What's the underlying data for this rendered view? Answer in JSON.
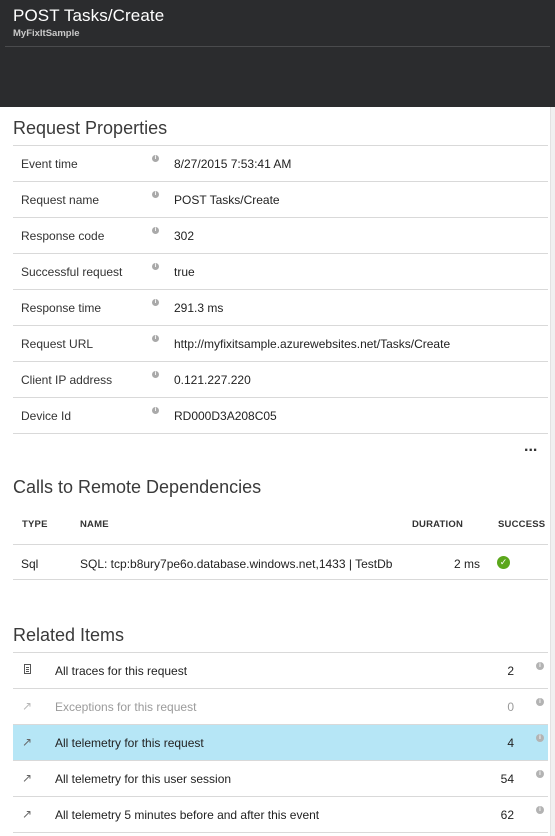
{
  "header": {
    "title": "POST Tasks/Create",
    "subtitle": "MyFixItSample"
  },
  "request_properties": {
    "title": "Request Properties",
    "rows": [
      {
        "label": "Event time",
        "value": "8/27/2015 7:53:41 AM"
      },
      {
        "label": "Request name",
        "value": "POST Tasks/Create"
      },
      {
        "label": "Response code",
        "value": "302"
      },
      {
        "label": "Successful request",
        "value": "true"
      },
      {
        "label": "Response time",
        "value": "291.3 ms"
      },
      {
        "label": "Request URL",
        "value": "http://myfixitsample.azurewebsites.net/Tasks/Create"
      },
      {
        "label": "Client IP address",
        "value": "0.121.227.220"
      },
      {
        "label": "Device Id",
        "value": "RD000D3A208C05"
      }
    ],
    "more_label": "..."
  },
  "dependencies": {
    "title": "Calls to Remote Dependencies",
    "columns": {
      "type": "TYPE",
      "name": "NAME",
      "duration": "DURATION",
      "success": "SUCCESS"
    },
    "rows": [
      {
        "type": "Sql",
        "name": "SQL: tcp:b8ury7pe6o.database.windows.net,1433 | TestDb",
        "duration": "2 ms",
        "success_icon": "check-circle-icon"
      }
    ]
  },
  "related_items": {
    "title": "Related Items",
    "rows": [
      {
        "icon": "document-icon",
        "label": "All traces for this request",
        "count": "2",
        "disabled": false,
        "selected": false
      },
      {
        "icon": "arrow-link-icon",
        "label": "Exceptions for this request",
        "count": "0",
        "disabled": true,
        "selected": false
      },
      {
        "icon": "arrow-link-icon",
        "label": "All telemetry for this request",
        "count": "4",
        "disabled": false,
        "selected": true
      },
      {
        "icon": "arrow-link-icon",
        "label": "All telemetry for this user session",
        "count": "54",
        "disabled": false,
        "selected": false
      },
      {
        "icon": "arrow-link-icon",
        "label": "All telemetry 5 minutes before and after this event",
        "count": "62",
        "disabled": false,
        "selected": false
      }
    ]
  },
  "colors": {
    "header_bg": "#2b2c2e",
    "selected_row": "#b6e6f6",
    "success": "#5ba71b"
  }
}
